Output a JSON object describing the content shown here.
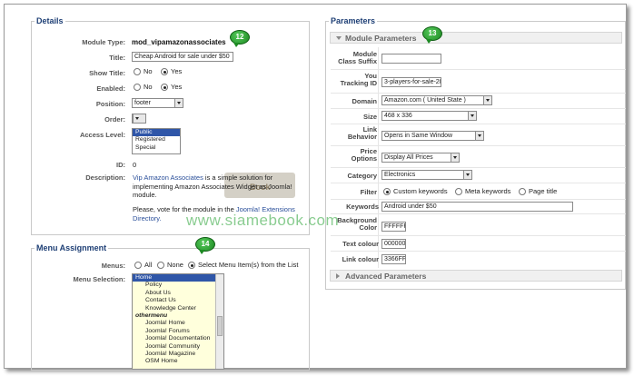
{
  "details": {
    "legend": "Details",
    "module_type_label": "Module Type:",
    "module_type_value": "mod_vipamazonassociates",
    "title_label": "Title:",
    "title_value": "Cheap Android for sale under $50",
    "show_title_label": "Show Title:",
    "enabled_label": "Enabled:",
    "no_label": "No",
    "yes_label": "Yes",
    "position_label": "Position:",
    "position_value": "footer",
    "order_label": "Order:",
    "access_label": "Access Level:",
    "access_options": [
      "Public",
      "Registered",
      "Special"
    ],
    "id_label": "ID:",
    "id_value": "0",
    "description_label": "Description:",
    "desc_link": "Vip Amazon Associates",
    "desc_line1_rest": "is a simple solution for",
    "desc_line2": "implementing Amazon Associates Widget as Joomla!",
    "desc_line3": "module.",
    "vote_text": "Please, vote for the module in the",
    "vote_link1": "Joomla! Extensions",
    "vote_link2": "Directory."
  },
  "menu": {
    "legend": "Menu Assignment",
    "menus_label": "Menus:",
    "all_label": "All",
    "none_label": "None",
    "select_label": "Select Menu Item(s) from the List",
    "selection_label": "Menu Selection:",
    "items": [
      "Home",
      "Policy",
      "About Us",
      "Contact Us",
      "Knowledge Center",
      "othermenu",
      "Joomla! Home",
      "Joomla! Forums",
      "Joomla! Documentation",
      "Joomla! Community",
      "Joomla! Magazine",
      "OSM Home"
    ]
  },
  "params": {
    "legend": "Parameters",
    "module_params_title": "Module Parameters",
    "suffix_label": "Module Class Suffix",
    "tracking_label": "You Tracking ID",
    "tracking_value": "3-players-for-sale-20",
    "domain_label": "Domain",
    "domain_value": "Amazon.com ( United State )",
    "size_label": "Size",
    "size_value": "468 x 336",
    "link_label": "Link Behavior",
    "link_value": "Opens in Same Window",
    "price_label": "Price Options",
    "price_value": "Display All Prices",
    "category_label": "Category",
    "category_value": "Electronics",
    "filter_label": "Filter",
    "filter_custom": "Custom keywords",
    "filter_meta": "Meta keywords",
    "filter_page": "Page title",
    "keywords_label": "Keywords",
    "keywords_value": "Android under $50",
    "bg_label": "Background Color",
    "bg_value": "FFFFFF",
    "text_label": "Text colour",
    "text_value": "000000",
    "link_colour_label": "Link colour",
    "link_colour_value": "3366FF",
    "advanced_title": "Advanced Parameters"
  },
  "badges": {
    "b12": "12",
    "b13": "13",
    "b14": "14"
  },
  "watermark": "www.siamebook.com",
  "stamp_text": "Book",
  "colors": {
    "legend": "#1e3f75",
    "badge": "#1d8a23",
    "selected": "#2f56a8"
  }
}
